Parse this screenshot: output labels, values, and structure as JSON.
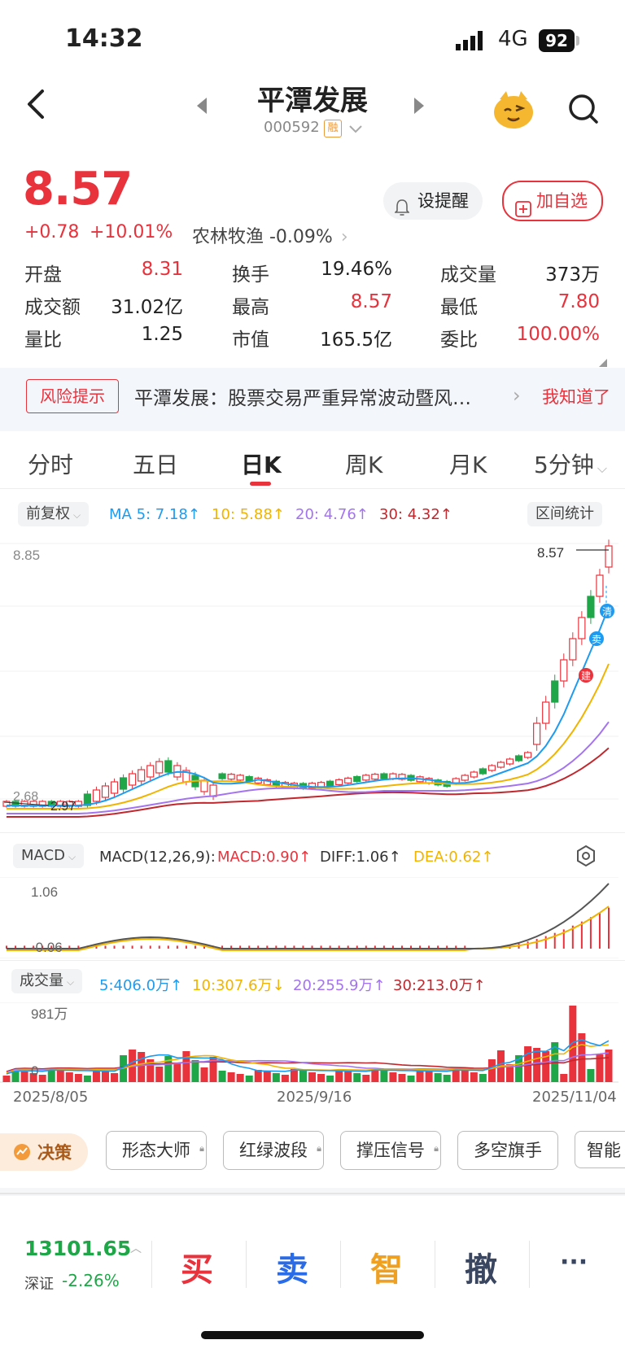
{
  "status_bar": {
    "time": "14:32",
    "network": "4G",
    "battery": "92"
  },
  "header": {
    "title": "平潭发展",
    "code": "000592",
    "margin_badge": "融"
  },
  "quote": {
    "price": "8.57",
    "change": "+0.78",
    "change_pct": "+10.01%",
    "industry": "农林牧渔 -0.09%",
    "remind_label": "设提醒",
    "add_label": "加自选"
  },
  "stats": [
    {
      "label": "开盘",
      "value": "8.31",
      "color": "#e8323c"
    },
    {
      "label": "换手",
      "value": "19.46%",
      "color": "#222"
    },
    {
      "label": "成交量",
      "value": "373万",
      "color": "#222"
    },
    {
      "label": "成交额",
      "value": "31.02亿",
      "color": "#222"
    },
    {
      "label": "最高",
      "value": "8.57",
      "color": "#e8323c"
    },
    {
      "label": "最低",
      "value": "7.80",
      "color": "#e8323c"
    },
    {
      "label": "量比",
      "value": "1.25",
      "color": "#222"
    },
    {
      "label": "市值",
      "value": "165.5亿",
      "color": "#222"
    },
    {
      "label": "委比",
      "value": "100.00%",
      "color": "#e8323c"
    }
  ],
  "risk": {
    "tag": "风险提示",
    "text": "平潭发展：股票交易严重异常波动暨风…",
    "action": "我知道了"
  },
  "tabs": [
    "分时",
    "五日",
    "日K",
    "周K",
    "月K",
    "5分钟"
  ],
  "active_tab": "日K",
  "kline": {
    "adjust_label": "前复权",
    "ma5": "MA 5: 7.18↑",
    "ma10": "10: 5.88↑",
    "ma20": "20: 4.76↑",
    "ma30": "30: 4.32↑",
    "range_stat": "区间统计",
    "top_label": "8.85",
    "high_label": "8.57",
    "low_label_a": "2.68",
    "low_label_b": "2.97",
    "marker_qing": "清",
    "marker_mai": "卖",
    "marker_jian": "建"
  },
  "macd": {
    "selector": "MACD",
    "params": "MACD(12,26,9):",
    "macd": "MACD:0.90↑",
    "diff": "DIFF:1.06↑",
    "dea": "DEA:0.62↑",
    "top_label": "1.06",
    "bottom_label": "-0.06"
  },
  "volume": {
    "selector": "成交量",
    "v5": "5:406.0万↑",
    "v10": "10:307.6万↓",
    "v20": "20:255.9万↑",
    "v30": "30:213.0万↑",
    "top_label": "981万",
    "zero_label": "0"
  },
  "dates": [
    "2025/8/05",
    "2025/9/16",
    "2025/11/04"
  ],
  "tools": {
    "main": "决策",
    "items": [
      "形态大师",
      "红绿波段",
      "撑压信号",
      "多空旗手",
      "智能"
    ]
  },
  "bottom": {
    "index_value": "13101.65",
    "index_name": "深证",
    "index_change": "-2.26%",
    "buy": "买",
    "sell": "卖",
    "smart": "智",
    "cancel": "撤",
    "more": "···"
  },
  "colors": {
    "up": "#e8323c",
    "down": "#1fa648",
    "ma5": "#1e9bf0",
    "ma10": "#f0b400",
    "ma20": "#a474f0",
    "ma30": "#c0282e"
  }
}
